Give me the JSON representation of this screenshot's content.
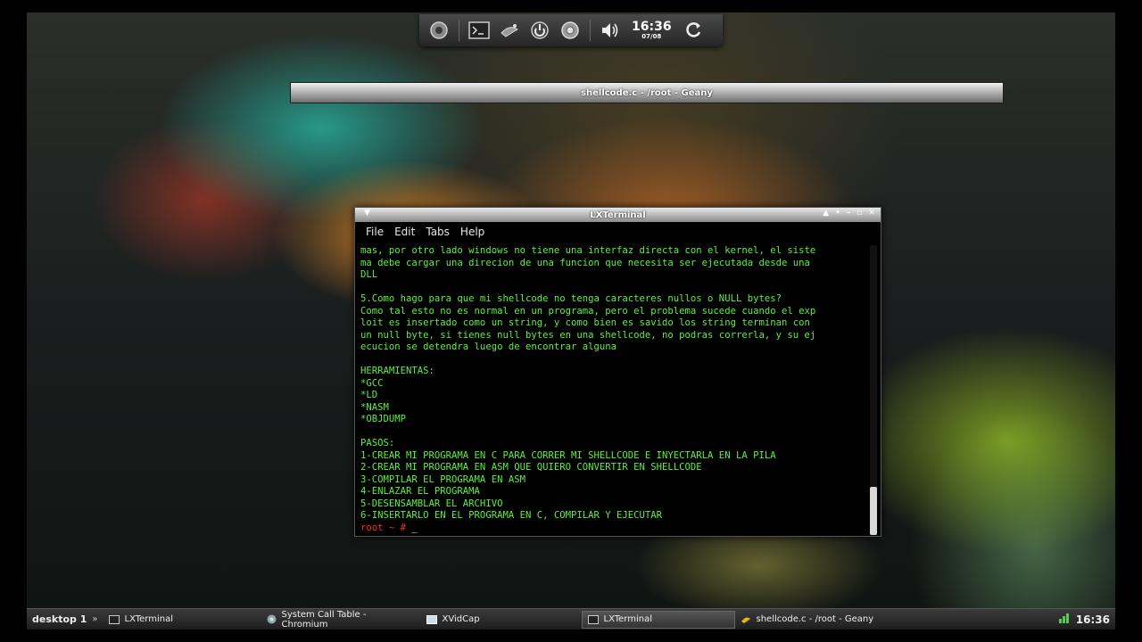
{
  "dock": {
    "icons": [
      "settings-icon",
      "terminal-icon",
      "wine-icon",
      "power-icon",
      "chrome-icon",
      "volume-icon",
      "refresh-icon"
    ],
    "clock_time": "16:36",
    "clock_date": "07/08"
  },
  "geany_window": {
    "title": "shellcode.c - /root - Geany"
  },
  "terminal": {
    "title": "LXTerminal",
    "menu": {
      "file": "File",
      "edit": "Edit",
      "tabs": "Tabs",
      "help": "Help"
    },
    "lines": [
      "mas, por otro lado windows no tiene una interfaz directa con el kernel, el siste",
      "ma debe cargar una direcion de una funcion que necesita ser ejecutada desde una",
      "DLL",
      "",
      "5.Como hago para que mi shellcode no tenga caracteres nullos o NULL bytes?",
      "Como tal esto no es normal en un programa, pero el problema sucede cuando el exp",
      "loit es insertado como un string, y como bien es savido los string terminan con",
      "un null byte, si tienes null bytes en una shellcode, no podras correrla, y su ej",
      "ecucion se detendra luego de encontrar alguna",
      "",
      "HERRAMIENTAS:",
      "*GCC",
      "*LD",
      "*NASM",
      "*OBJDUMP",
      "",
      "PASOS:",
      "1-CREAR MI PROGRAMA EN C PARA CORRER MI SHELLCODE E INYECTARLA EN LA PILA",
      "2-CREAR MI PROGRAMA EN ASM QUE QUIERO CONVERTIR EN SHELLCODE",
      "3-COMPILAR EL PROGRAMA EN ASM",
      "4-ENLAZAR EL PROGRAMA",
      "5-DESENSAMBLAR EL ARCHIVO",
      "6-INSERTARLO EN EL PROGRAMA EN C, COMPILAR Y EJECUTAR"
    ],
    "prompt": "root ~ #",
    "cursor": "_"
  },
  "taskbar": {
    "desktop_label": "desktop 1",
    "arrows": "»",
    "tasks": [
      {
        "label": "LXTerminal",
        "icon": "terminal-icon"
      },
      {
        "label": "System Call Table - Chromium",
        "icon": "chromium-icon"
      },
      {
        "label": "XVidCap",
        "icon": "xvidcap-icon"
      },
      {
        "label": "LXTerminal",
        "icon": "terminal-icon"
      },
      {
        "label": "shellcode.c - /root - Geany",
        "icon": "geany-icon"
      }
    ],
    "clock": "16:36"
  }
}
